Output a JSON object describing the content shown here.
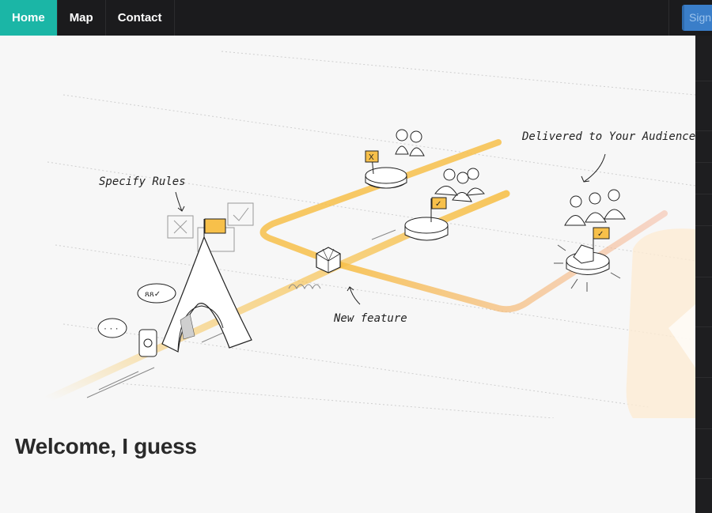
{
  "nav": {
    "items": [
      {
        "label": "Home",
        "active": true
      },
      {
        "label": "Map",
        "active": false
      },
      {
        "label": "Contact",
        "active": false
      }
    ],
    "signin_label": "Sign",
    "signin_color": "#3a7ec9",
    "active_color": "#1bb6a6"
  },
  "hero": {
    "annotations": {
      "specify_rules": "Specify Rules",
      "new_feature": "New feature",
      "delivered": "Delivered to Your Audience"
    },
    "accent_color": "#f7c04a"
  },
  "page": {
    "title": "Welcome, I guess"
  }
}
